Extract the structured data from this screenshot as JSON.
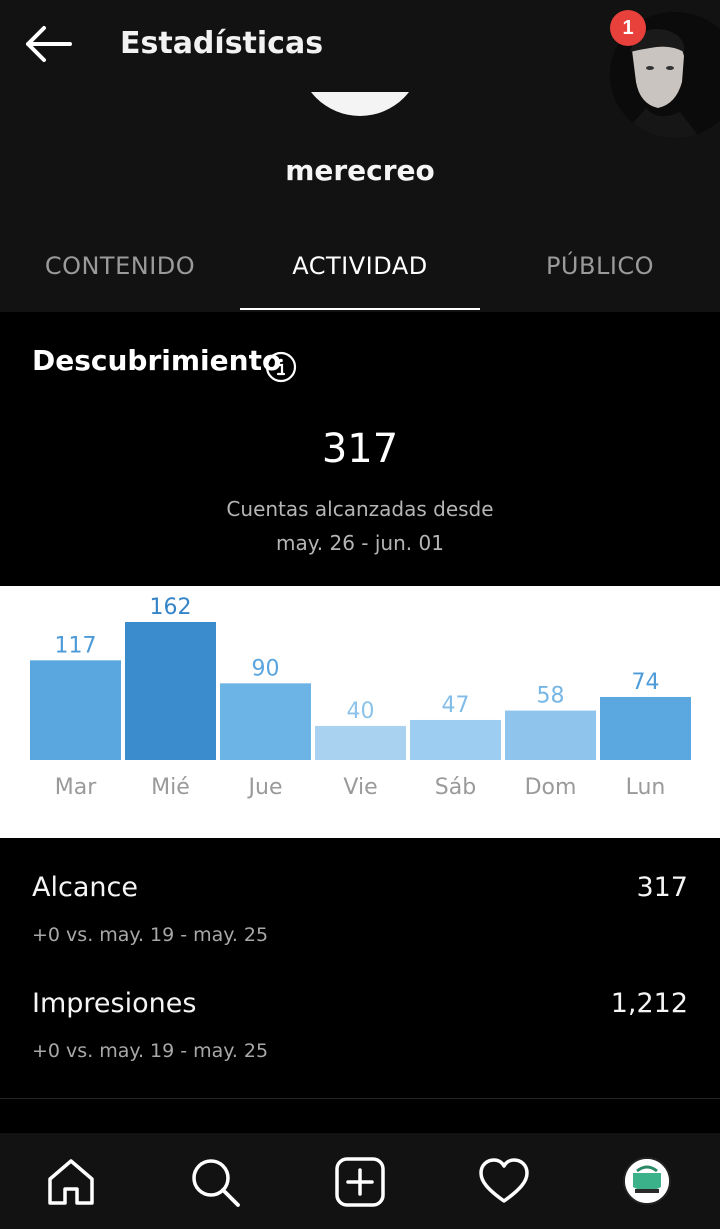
{
  "header": {
    "title": "Estadísticas",
    "notification_count": "1",
    "back_icon": "arrow-left-icon"
  },
  "profile": {
    "username": "merecreo"
  },
  "tabs": [
    {
      "label": "CONTENIDO",
      "active": false
    },
    {
      "label": "ACTIVIDAD",
      "active": true
    },
    {
      "label": "PÚBLICO",
      "active": false
    }
  ],
  "discovery": {
    "title": "Descubrimiento",
    "total": "317",
    "subtitle_line1": "Cuentas alcanzadas desde",
    "subtitle_line2": "may. 26 - jun. 01"
  },
  "chart_data": {
    "type": "bar",
    "categories": [
      "Mar",
      "Mié",
      "Jue",
      "Vie",
      "Sáb",
      "Dom",
      "Lun"
    ],
    "values": [
      117,
      162,
      90,
      40,
      47,
      58,
      74
    ],
    "colors": [
      "#5aa7df",
      "#3b8ccc",
      "#6cb3e6",
      "#a8d2f0",
      "#9dcdf0",
      "#8fc5ed",
      "#5ba8e0"
    ],
    "label_colors": [
      "#4c9ad8",
      "#3584c8",
      "#5aa5de",
      "#8dc3ea",
      "#82bce8",
      "#76b6e5",
      "#4d9bd8"
    ]
  },
  "metrics": [
    {
      "label": "Alcance",
      "value": "317",
      "sub": "+0 vs. may. 19 - may. 25"
    },
    {
      "label": "Impresiones",
      "value": "1,212",
      "sub": "+0 vs. may. 19 - may. 25"
    }
  ],
  "bottom_nav": {
    "items": [
      "home-icon",
      "search-icon",
      "add-post-icon",
      "heart-icon",
      "profile-avatar"
    ]
  },
  "colors": {
    "background": "#000000",
    "header_bg": "#121212",
    "badge": "#e8403a"
  }
}
